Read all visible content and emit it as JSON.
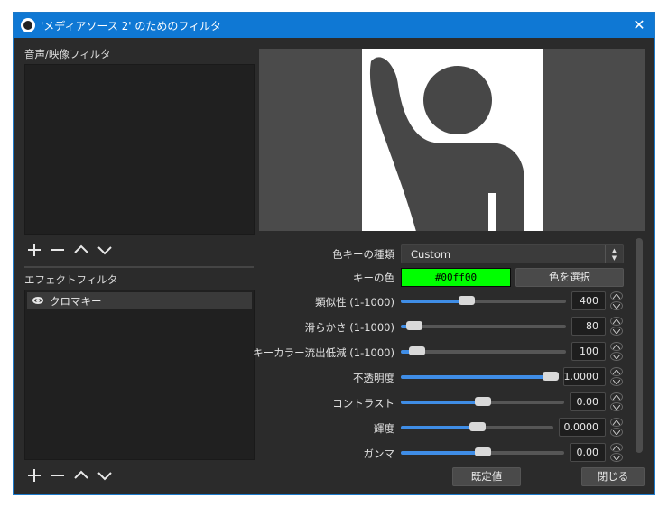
{
  "window": {
    "title": "'メディアソース 2' のためのフィルタ",
    "close_glyph": "✕"
  },
  "audio_video_filters": {
    "label": "音声/映像フィルタ"
  },
  "effect_filters": {
    "label": "エフェクトフィルタ",
    "items": [
      {
        "name": "クロマキー",
        "icon": "eye-icon"
      }
    ]
  },
  "toolbar": {
    "add": "+",
    "remove": "−"
  },
  "properties": {
    "key_color_type": {
      "label": "色キーの種類",
      "value": "Custom"
    },
    "key_color": {
      "label": "キーの色",
      "value": "#00ff00",
      "swatch": "#00ff00",
      "select_button": "色を選択"
    },
    "similarity": {
      "label": "類似性 (1-1000)",
      "value": "400",
      "fraction": 0.4
    },
    "smoothness": {
      "label": "滑らかさ (1-1000)",
      "value": "80",
      "fraction": 0.08
    },
    "spill": {
      "label": "キーカラー流出低減 (1-1000)",
      "value": "100",
      "fraction": 0.1
    },
    "opacity": {
      "label": "不透明度",
      "value": "1.0000",
      "fraction": 1.0
    },
    "contrast": {
      "label": "コントラスト",
      "value": "0.00",
      "fraction": 0.5
    },
    "brightness": {
      "label": "輝度",
      "value": "0.0000",
      "fraction": 0.5
    },
    "gamma": {
      "label": "ガンマ",
      "value": "0.00",
      "fraction": 0.5
    }
  },
  "footer": {
    "defaults": "既定値",
    "close": "閉じる"
  },
  "colors": {
    "accent": "#3f8de6",
    "titlebar": "#0f78d4",
    "background": "#2b2b2b"
  }
}
